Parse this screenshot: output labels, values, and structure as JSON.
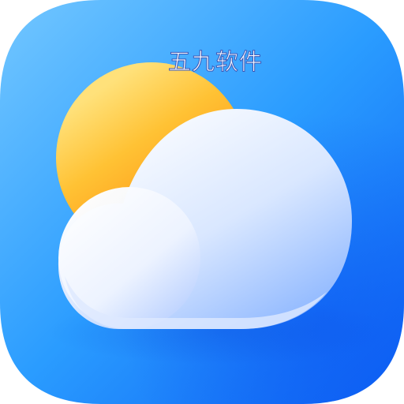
{
  "icon": {
    "name": "weather-app-icon",
    "symbol": "sun-behind-cloud-icon",
    "colors": {
      "background_light": "#6ec4ff",
      "background_mid": "#1f98ff",
      "background_dark": "#0b63f5",
      "sun_light": "#ffd25c",
      "sun_dark": "#ff9c0f",
      "cloud_light": "#ffffff",
      "cloud_dark": "#8bb5ff"
    }
  },
  "watermark": {
    "text": "五九软件"
  }
}
